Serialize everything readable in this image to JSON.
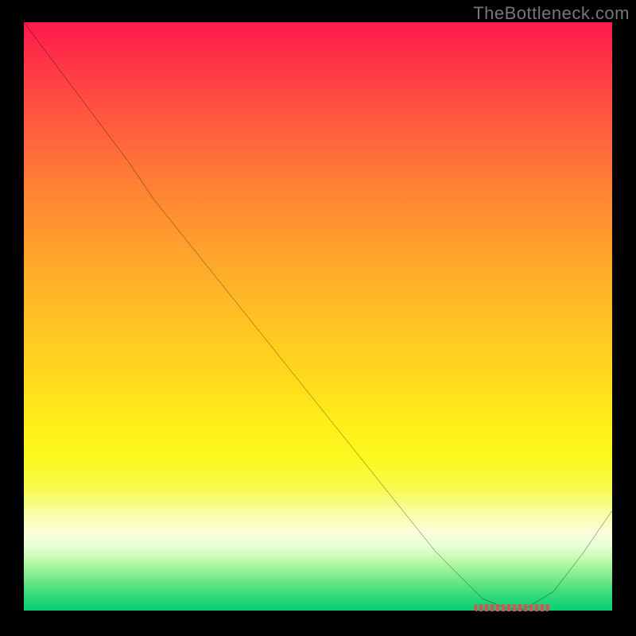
{
  "watermark": "TheBottleneck.com",
  "chart_data": {
    "type": "line",
    "title": "",
    "xlabel": "",
    "ylabel": "",
    "xlim": [
      0,
      100
    ],
    "ylim": [
      0,
      100
    ],
    "grid": false,
    "legend": false,
    "series": [
      {
        "name": "bottleneck-curve",
        "x": [
          0,
          6,
          12,
          18,
          22,
          30,
          40,
          50,
          60,
          70,
          78,
          82,
          85,
          90,
          95,
          100
        ],
        "values": [
          100,
          92,
          84,
          76,
          70,
          60,
          47.5,
          35,
          22.5,
          10,
          2,
          0.4,
          0.2,
          3.2,
          9.7,
          17
        ]
      }
    ],
    "optimal_range": {
      "x_start": 76.5,
      "x_end": 89.5,
      "y": 0.6
    },
    "gradient_stops": [
      {
        "pct": 0,
        "color": "#ff1a4d"
      },
      {
        "pct": 6,
        "color": "#ff3247"
      },
      {
        "pct": 15,
        "color": "#ff5440"
      },
      {
        "pct": 24,
        "color": "#ff7438"
      },
      {
        "pct": 33,
        "color": "#ff9130"
      },
      {
        "pct": 42,
        "color": "#ffab2a"
      },
      {
        "pct": 51,
        "color": "#ffc322"
      },
      {
        "pct": 60,
        "color": "#ffd91c"
      },
      {
        "pct": 68,
        "color": "#ffee1a"
      },
      {
        "pct": 74,
        "color": "#fcf81f"
      },
      {
        "pct": 79,
        "color": "#f7fb4a"
      },
      {
        "pct": 83,
        "color": "#f7fd9c"
      },
      {
        "pct": 86.5,
        "color": "#fbffd8"
      },
      {
        "pct": 89,
        "color": "#e9ffd8"
      },
      {
        "pct": 91,
        "color": "#c8fbb2"
      },
      {
        "pct": 93,
        "color": "#9bf396"
      },
      {
        "pct": 95,
        "color": "#6ae785"
      },
      {
        "pct": 97.5,
        "color": "#32d97a"
      },
      {
        "pct": 100,
        "color": "#06cf72"
      }
    ]
  }
}
